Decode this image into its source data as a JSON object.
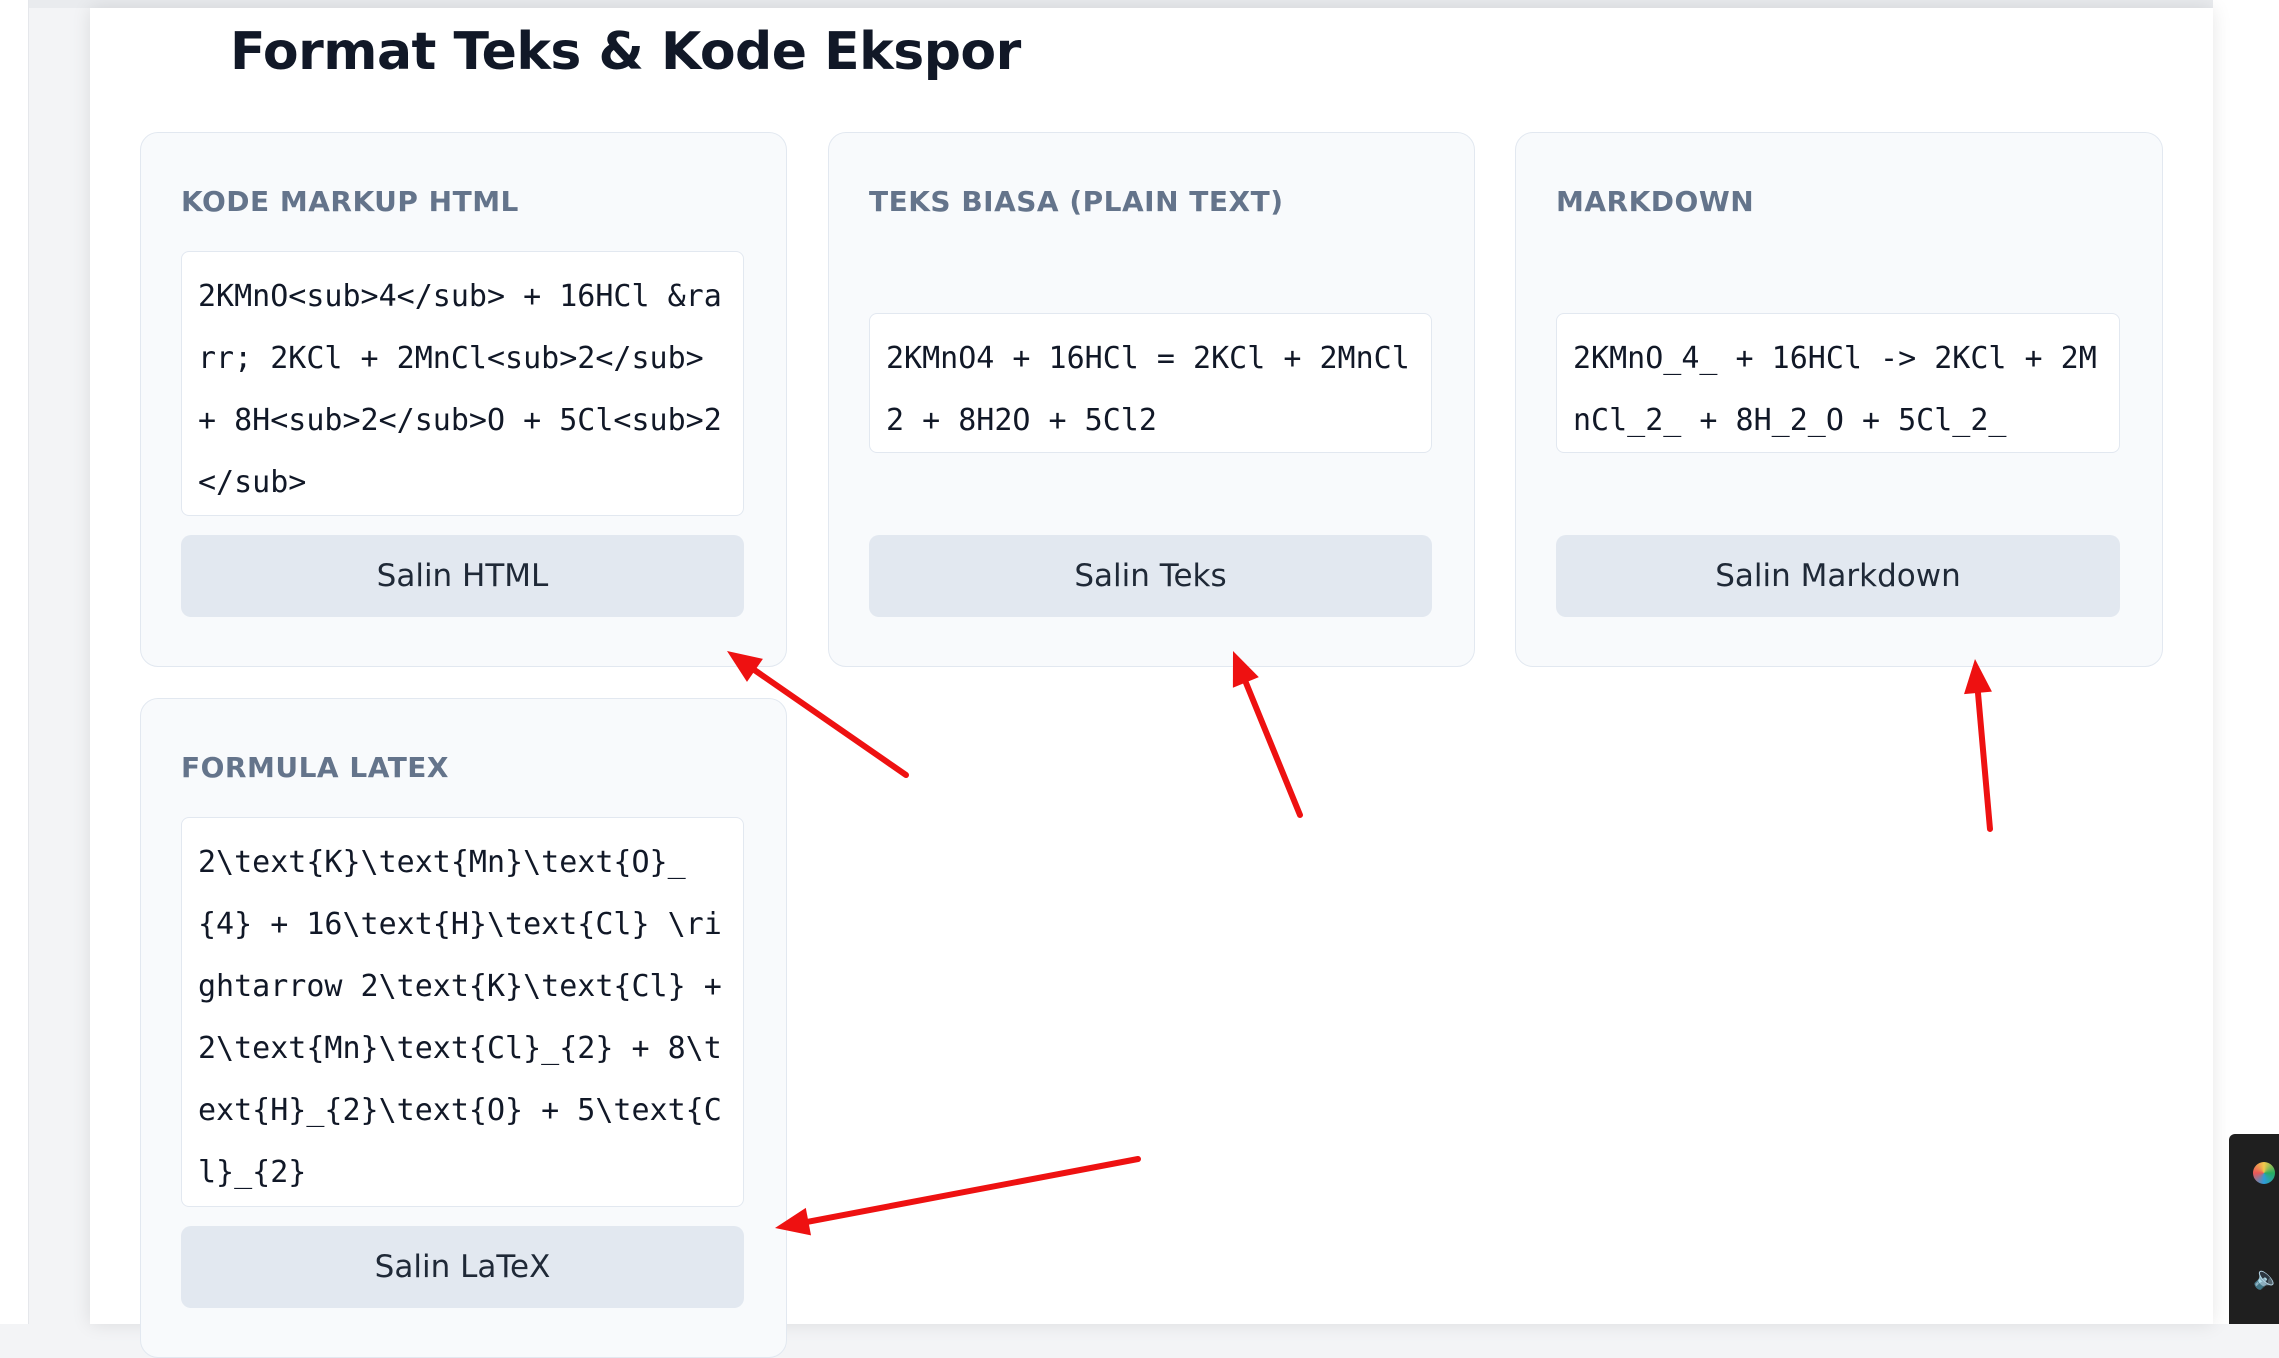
{
  "section": {
    "title": "Format Teks & Kode Ekspor"
  },
  "cards": [
    {
      "id": "html",
      "label": "KODE MARKUP HTML",
      "code": "2KMnO<sub>4</sub> + 16HCl &rarr; 2KCl + 2MnCl<sub>2</sub> + 8H<sub>2</sub>O + 5Cl<sub>2</sub>",
      "button": "Salin HTML"
    },
    {
      "id": "plain",
      "label": "TEKS BIASA (PLAIN TEXT)",
      "code": "2KMnO4 + 16HCl = 2KCl + 2MnCl2 + 8H2O + 5Cl2",
      "button": "Salin Teks"
    },
    {
      "id": "markdown",
      "label": "MARKDOWN",
      "code": "2KMnO_4_ + 16HCl -> 2KCl + 2MnCl_2_ + 8H_2_O + 5Cl_2_",
      "button": "Salin Markdown"
    },
    {
      "id": "latex",
      "label": "FORMULA LATEX",
      "code": "2\\text{K}\\text{Mn}\\text{O}_{4} + 16\\text{H}\\text{Cl} \\rightarrow 2\\text{K}\\text{Cl} + 2\\text{Mn}\\text{Cl}_{2} + 8\\text{H}_{2}\\text{O} + 5\\text{Cl}_{2}",
      "button": "Salin LaTeX"
    }
  ],
  "annotations": {
    "arrow_color": "#ee1111"
  },
  "icons": [
    "speaker-icon",
    "app-tray-icon"
  ]
}
